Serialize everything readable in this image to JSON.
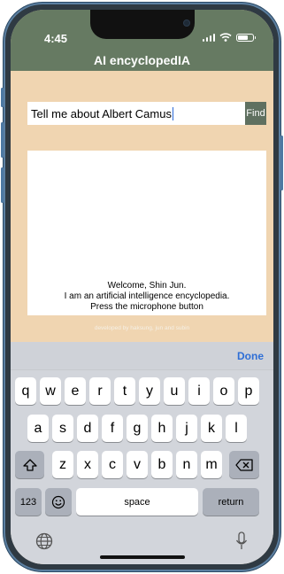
{
  "status_bar": {
    "time": "4:45"
  },
  "app": {
    "title": "AI encyclopedIA"
  },
  "search": {
    "value": "Tell me about Albert Camus",
    "button_label": "Find"
  },
  "panel": {
    "lines": [
      "Welcome, Shin Jun.",
      "I am an artificial intelligence encyclopedia.",
      "Press the microphone button"
    ]
  },
  "credit": "developed by haksung, jun and subin",
  "keyboard": {
    "done_label": "Done",
    "row1": [
      "q",
      "w",
      "e",
      "r",
      "t",
      "y",
      "u",
      "i",
      "o",
      "p"
    ],
    "row2": [
      "a",
      "s",
      "d",
      "f",
      "g",
      "h",
      "j",
      "k",
      "l"
    ],
    "row3": [
      "z",
      "x",
      "c",
      "v",
      "b",
      "n",
      "m"
    ],
    "numbers_label": "123",
    "space_label": "space",
    "return_label": "return"
  },
  "colors": {
    "header": "#667a62",
    "background": "#f0d5b1",
    "find_button": "#5f7060",
    "done": "#2f6fd6"
  }
}
